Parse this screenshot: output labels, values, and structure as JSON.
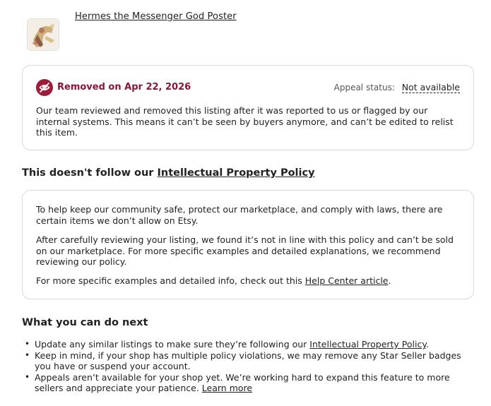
{
  "listing": {
    "title": "Hermes the Messenger God Poster",
    "thumbnail_icon": "poster-thumbnail"
  },
  "removed_card": {
    "icon": "eye-slash-icon",
    "removed_label": "Removed on Apr 22, 2026",
    "appeal_label": "Appeal status:",
    "appeal_value": "Not available",
    "body": "Our team reviewed and removed this listing after it was reported to us or flagged by our internal systems. This means it can’t be seen by buyers anymore, and can’t be edited to relist this item."
  },
  "policy_section": {
    "heading_prefix": "This doesn't follow our ",
    "heading_link": "Intellectual Property Policy",
    "para1": "To help keep our community safe, protect our marketplace, and comply with laws, there are certain items we don’t allow on Etsy.",
    "para2": "After carefully reviewing your listing, we found it’s not in line with this policy and can’t be sold on our marketplace. For more specific examples and detailed explanations, we recommend reviewing our policy.",
    "para3_prefix": "For more specific examples and detailed info, check out this ",
    "para3_link": "Help Center article",
    "para3_suffix": "."
  },
  "next_section": {
    "heading": "What you can do next",
    "item1_prefix": "Update any similar listings to make sure they’re following our ",
    "item1_link": "Intellectual Property Policy",
    "item1_suffix": ".",
    "item2": "Keep in mind, if your shop has multiple policy violations, we may remove any Star Seller badges you have or suspend your account.",
    "item3_prefix": "Appeals aren’t available for your shop yet. We’re working hard to expand this feature to more sellers and appreciate your patience. ",
    "item3_link": "Learn more"
  },
  "colors": {
    "removed_red": "#8a1538",
    "icon_bg": "#9e1b3a",
    "border": "#d9d9d9"
  }
}
